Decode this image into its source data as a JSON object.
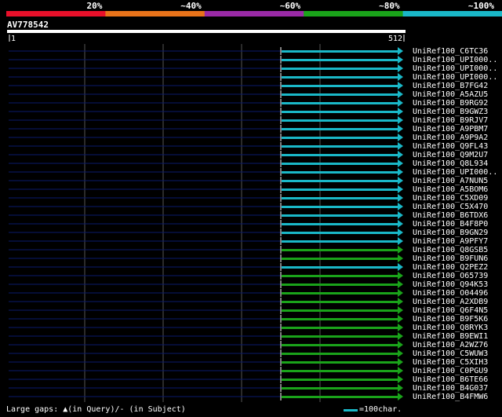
{
  "scale": {
    "labels": [
      "20%",
      "~40%",
      "~60%",
      "~80%",
      "~100%"
    ],
    "colors": [
      "#e8102a",
      "#e8731a",
      "#9a2aa6",
      "#1aa31a",
      "#1ab8c8"
    ]
  },
  "query": {
    "id": "AV778542",
    "start": "1",
    "end": "512",
    "length": 512
  },
  "hits": [
    {
      "name": "UniRef100_C6TC36",
      "color": "#1ab8c8"
    },
    {
      "name": "UniRef100_UPI000..",
      "color": "#1ab8c8"
    },
    {
      "name": "UniRef100_UPI000..",
      "color": "#1ab8c8"
    },
    {
      "name": "UniRef100_UPI000..",
      "color": "#1ab8c8"
    },
    {
      "name": "UniRef100_B7FG42",
      "color": "#1ab8c8"
    },
    {
      "name": "UniRef100_A5AZU5",
      "color": "#1ab8c8"
    },
    {
      "name": "UniRef100_B9RG92",
      "color": "#1ab8c8"
    },
    {
      "name": "UniRef100_B9GWZ3",
      "color": "#1ab8c8"
    },
    {
      "name": "UniRef100_B9RJV7",
      "color": "#1ab8c8"
    },
    {
      "name": "UniRef100_A9PBM7",
      "color": "#1ab8c8"
    },
    {
      "name": "UniRef100_A9P9A2",
      "color": "#1ab8c8"
    },
    {
      "name": "UniRef100_Q9FL43",
      "color": "#1ab8c8"
    },
    {
      "name": "UniRef100_Q9M2U7",
      "color": "#1ab8c8"
    },
    {
      "name": "UniRef100_Q8L934",
      "color": "#1ab8c8"
    },
    {
      "name": "UniRef100_UPI000..",
      "color": "#1ab8c8"
    },
    {
      "name": "UniRef100_A7NUN5",
      "color": "#1ab8c8"
    },
    {
      "name": "UniRef100_A5BOM6",
      "color": "#1ab8c8"
    },
    {
      "name": "UniRef100_C5XD09",
      "color": "#1ab8c8"
    },
    {
      "name": "UniRef100_C5X470",
      "color": "#1ab8c8"
    },
    {
      "name": "UniRef100_B6TDX6",
      "color": "#1ab8c8"
    },
    {
      "name": "UniRef100_B4F8P0",
      "color": "#1ab8c8"
    },
    {
      "name": "UniRef100_B9GN29",
      "color": "#1ab8c8"
    },
    {
      "name": "UniRef100_A9PFY7",
      "color": "#1ab8c8"
    },
    {
      "name": "UniRef100_Q8GSB5",
      "color": "#1aa31a"
    },
    {
      "name": "UniRef100_B9FUN6",
      "color": "#1aa31a"
    },
    {
      "name": "UniRef100_Q2PEZ2",
      "color": "#1ab8c8"
    },
    {
      "name": "UniRef100_O65739",
      "color": "#1aa31a"
    },
    {
      "name": "UniRef100_Q94K53",
      "color": "#1aa31a"
    },
    {
      "name": "UniRef100_O04496",
      "color": "#1aa31a"
    },
    {
      "name": "UniRef100_A2XDB9",
      "color": "#1aa31a"
    },
    {
      "name": "UniRef100_Q6F4N5",
      "color": "#1aa31a"
    },
    {
      "name": "UniRef100_B9F5K6",
      "color": "#1aa31a"
    },
    {
      "name": "UniRef100_Q8RYK3",
      "color": "#1aa31a"
    },
    {
      "name": "UniRef100_B9EWI1",
      "color": "#1aa31a"
    },
    {
      "name": "UniRef100_A2WZ76",
      "color": "#1aa31a"
    },
    {
      "name": "UniRef100_C5WUW3",
      "color": "#1aa31a"
    },
    {
      "name": "UniRef100_C5XIH3",
      "color": "#1aa31a"
    },
    {
      "name": "UniRef100_C0PGU9",
      "color": "#1aa31a"
    },
    {
      "name": "UniRef100_B6TE66",
      "color": "#1aa31a"
    },
    {
      "name": "UniRef100_B4G037",
      "color": "#1aa31a"
    },
    {
      "name": "UniRef100_B4FMW6",
      "color": "#1aa31a"
    }
  ],
  "legend": {
    "gaps_text": "Large gaps: ▲(in Query)/‐ (in Subject)",
    "scale_text": "=100char.",
    "scale_color": "#1ab8c8"
  },
  "colors": {
    "background": "#000000",
    "track": "#0a1a6b",
    "grid": "#555555"
  }
}
